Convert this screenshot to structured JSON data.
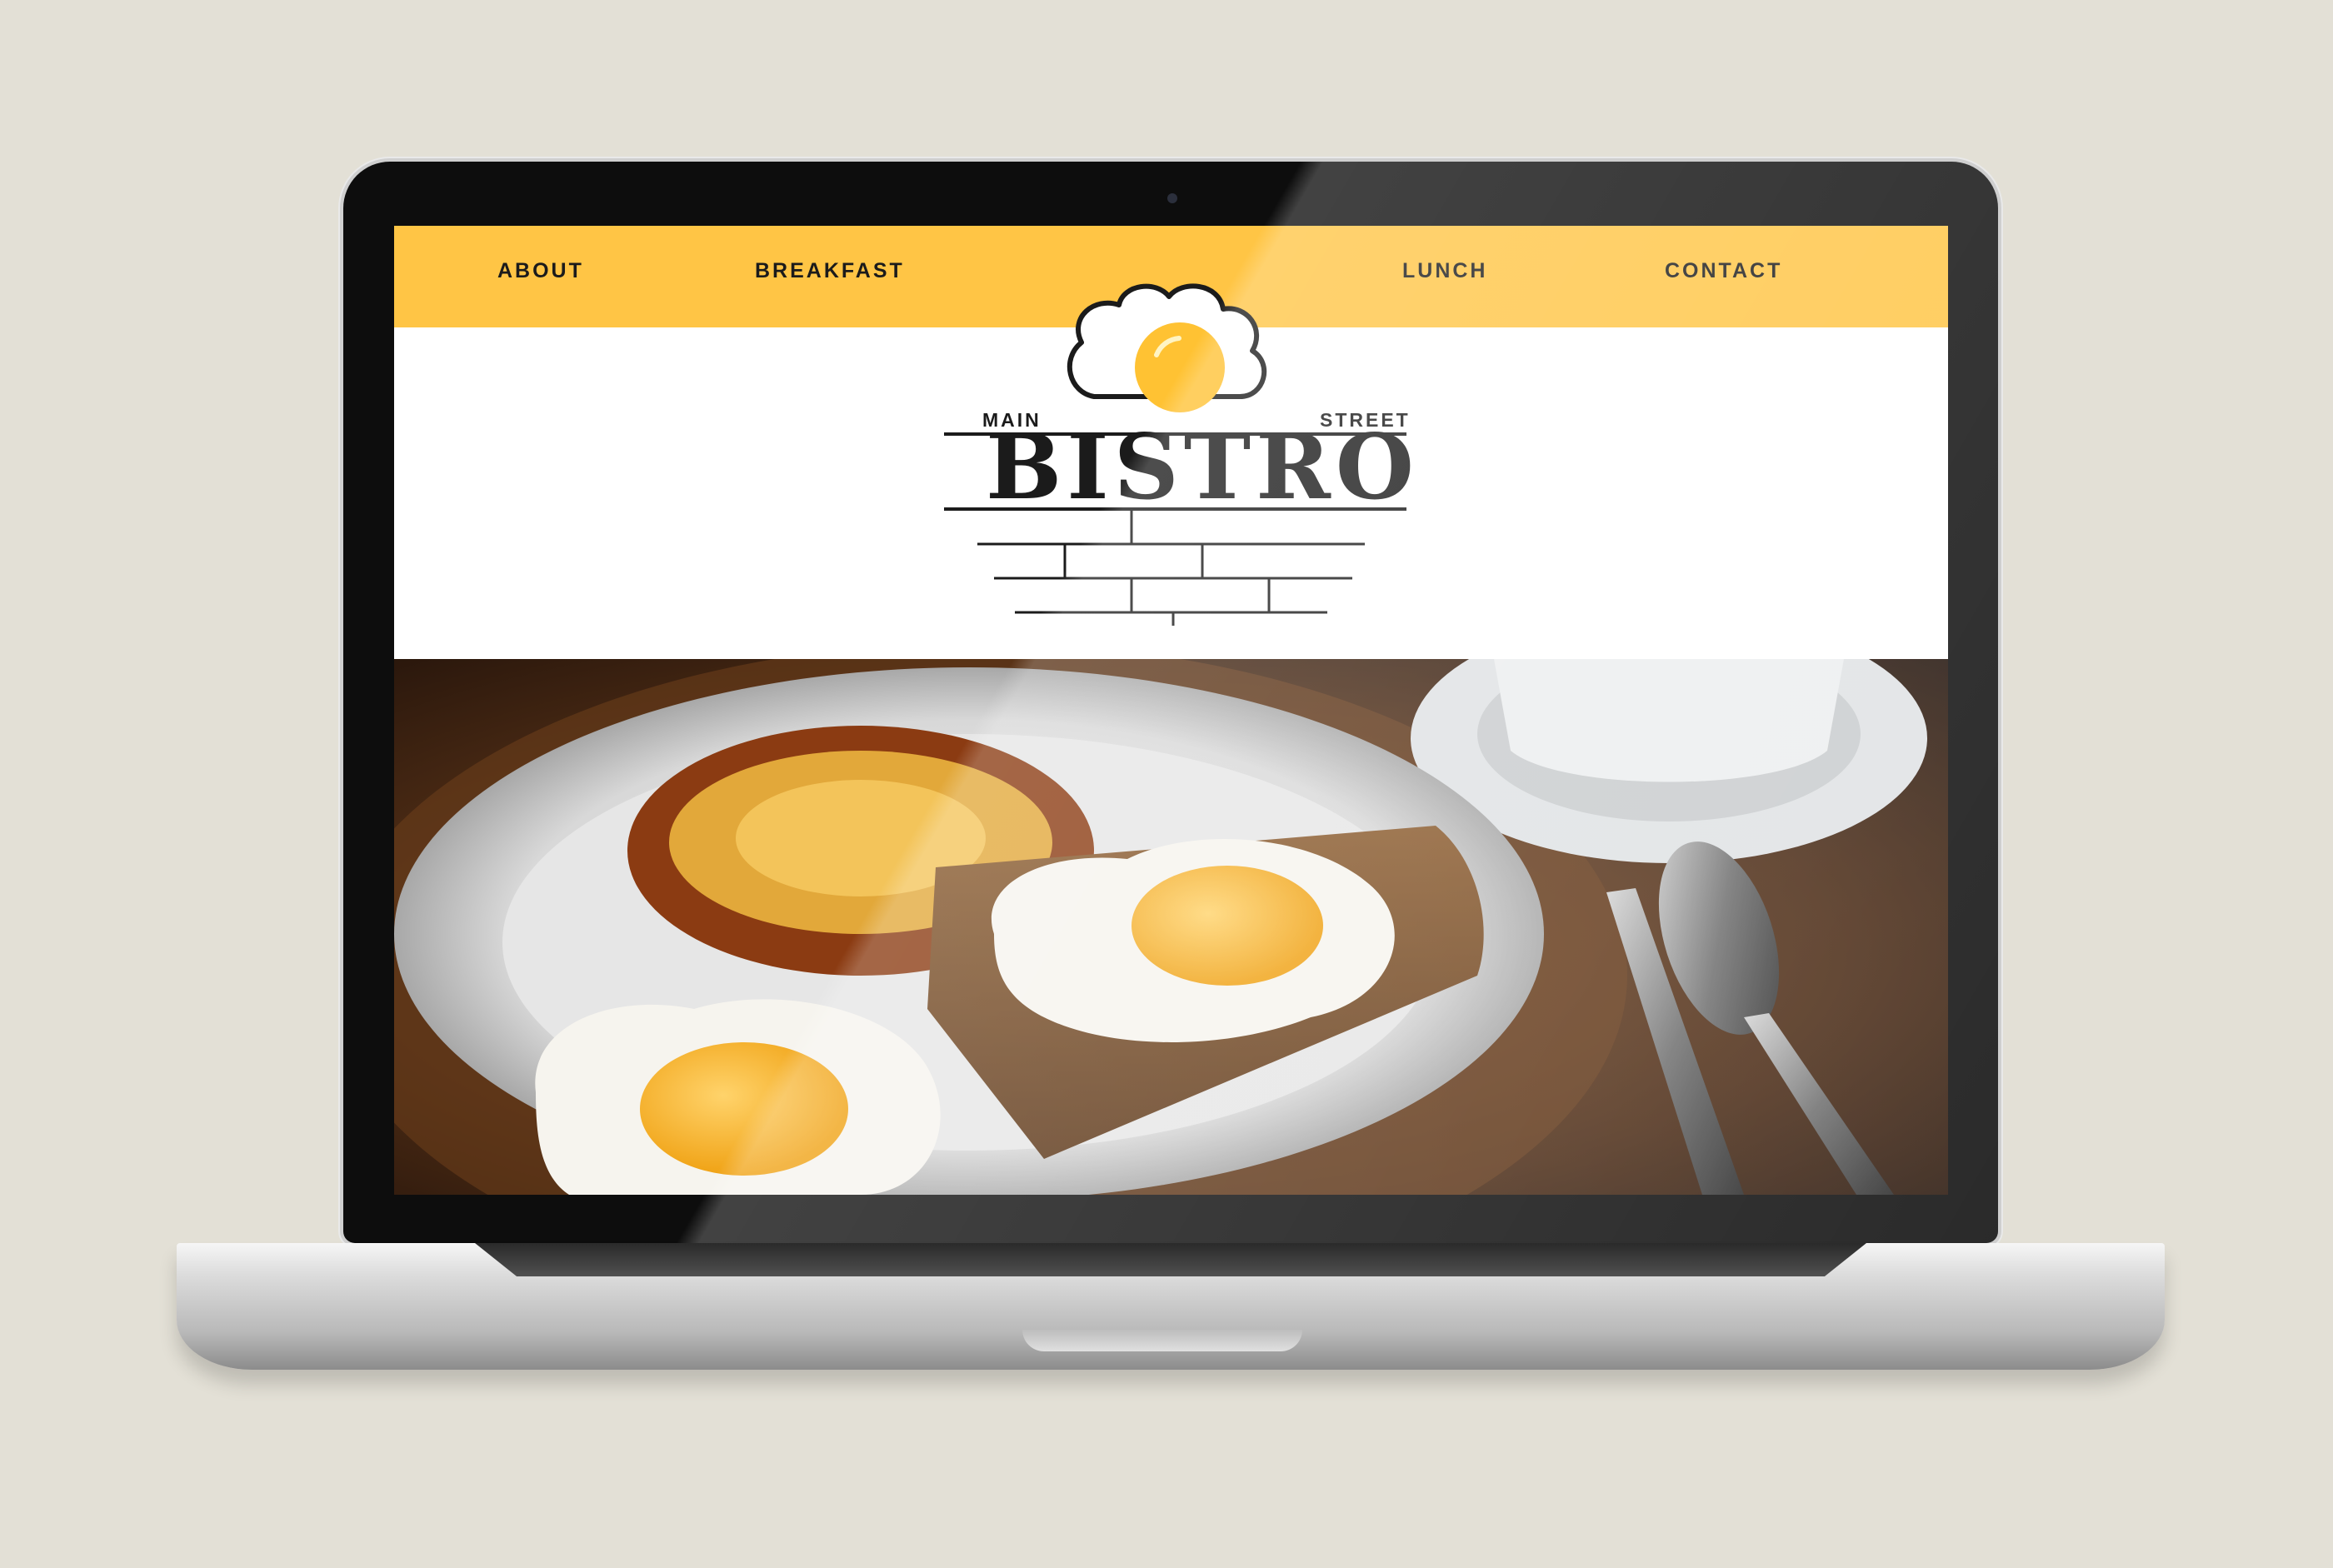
{
  "nav": {
    "about": "ABOUT",
    "breakfast": "BREAKFAST",
    "lunch": "LUNCH",
    "contact": "CONTACT"
  },
  "logo": {
    "main": "MAIN",
    "street": "STREET",
    "title": "BISTRO"
  },
  "colors": {
    "nav_bar": "#ffc545",
    "egg_yolk": "#ffc233",
    "ink": "#1b1b1b"
  },
  "hero": {
    "icon": "breakfast-photo"
  }
}
